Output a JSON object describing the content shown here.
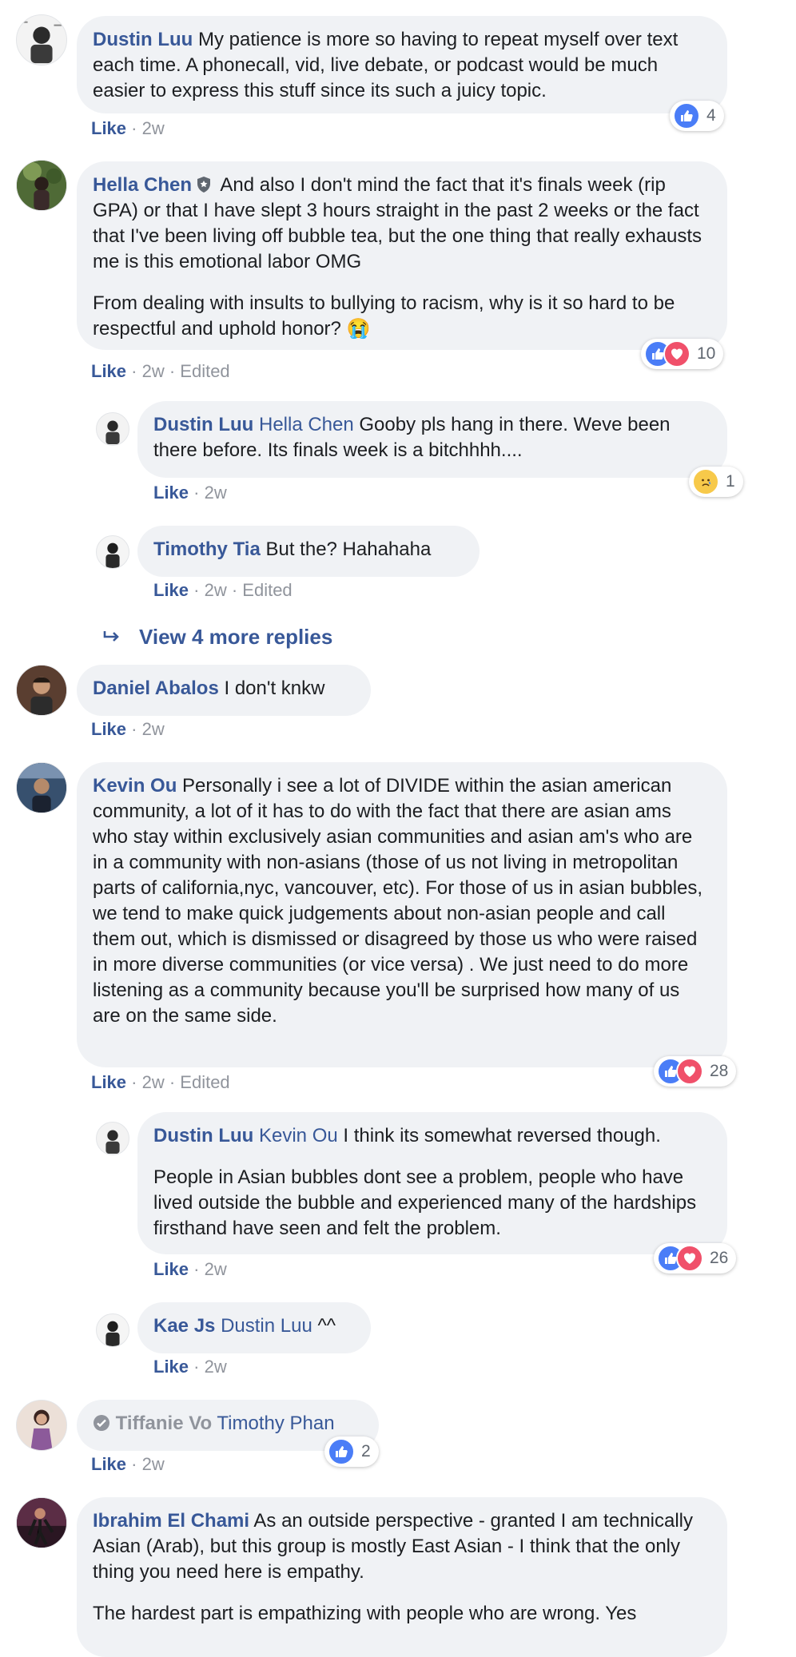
{
  "comments": [
    {
      "author": "Dustin Luu",
      "text": " My patience is more so having to repeat myself over text each time. A phonecall, vid, live debate, or podcast would be much easier to express this stuff since its such a juicy topic.",
      "like": "Like",
      "time": "· 2w",
      "reaction_count": "4"
    },
    {
      "author": "Hella Chen",
      "text": " And also I don't mind the fact that it's finals week (rip GPA) or that I have slept 3 hours straight in the past 2 weeks or the fact that I've been living off bubble tea, but the one thing that really exhausts me is this emotional labor OMG",
      "text2": "From dealing with insults to bullying to racism, why is it so hard to be respectful and uphold honor? 😭",
      "like": "Like",
      "time": "· 2w",
      "edited": "· Edited",
      "reaction_count": "10"
    },
    {
      "author": "Dustin Luu",
      "tag": "Hella Chen",
      "text": " Gooby pls hang in there. Weve been there before. Its finals week is a bitchhhh....",
      "like": "Like",
      "time": "· 2w",
      "reaction_count": "1"
    },
    {
      "author": "Timothy Tia",
      "text": " But the? Hahahaha",
      "like": "Like",
      "time": "· 2w",
      "edited": "· Edited"
    },
    {
      "author": "Daniel Abalos",
      "text": " I don't knkw",
      "like": "Like",
      "time": "· 2w"
    },
    {
      "author": "Kevin Ou",
      "text": " Personally i see a lot of DIVIDE within the asian american community, a lot of it has to do with the fact that there are asian ams who stay within exclusively asian communities and asian am's who are in a community with non-asians (those of us not living in metropolitan parts of california,nyc, vancouver, etc). For those of us in asian bubbles, we tend to make quick judgements about non-asian people and call them out, which is dismissed or disagreed by those us who were raised in more diverse communities (or vice versa) . We just need to do more listening as a community because you'll be surprised how many of us are on the same side.",
      "like": "Like",
      "time": "· 2w",
      "edited": "· Edited",
      "reaction_count": "28"
    },
    {
      "author": "Dustin Luu",
      "tag": "Kevin Ou",
      "text": " I think its somewhat reversed though.",
      "text2": "People in Asian bubbles dont see a problem, people who have lived outside the bubble and experienced many of the hardships firsthand have seen and felt the problem.",
      "like": "Like",
      "time": "· 2w",
      "reaction_count": "26"
    },
    {
      "author": "Kae Js",
      "tag": "Dustin Luu",
      "text": " ^^",
      "like": "Like",
      "time": "· 2w"
    },
    {
      "author": "Tiffanie Vo",
      "tag": "Timothy Phan",
      "like": "Like",
      "time": "· 2w",
      "reaction_count": "2"
    },
    {
      "author": "Ibrahim El Chami",
      "text": " As an outside perspective - granted I am technically Asian (Arab), but this group is mostly East Asian - I think that the only thing you need here is empathy.",
      "text2": "The hardest part is empathizing with people who are wrong. Yes"
    }
  ],
  "view_more": "View 4 more replies",
  "colors": {
    "link": "#385898",
    "bubble": "#f0f2f5",
    "meta": "#90949c",
    "like_reaction": "#4a7df7",
    "love_reaction": "#f0506a"
  }
}
